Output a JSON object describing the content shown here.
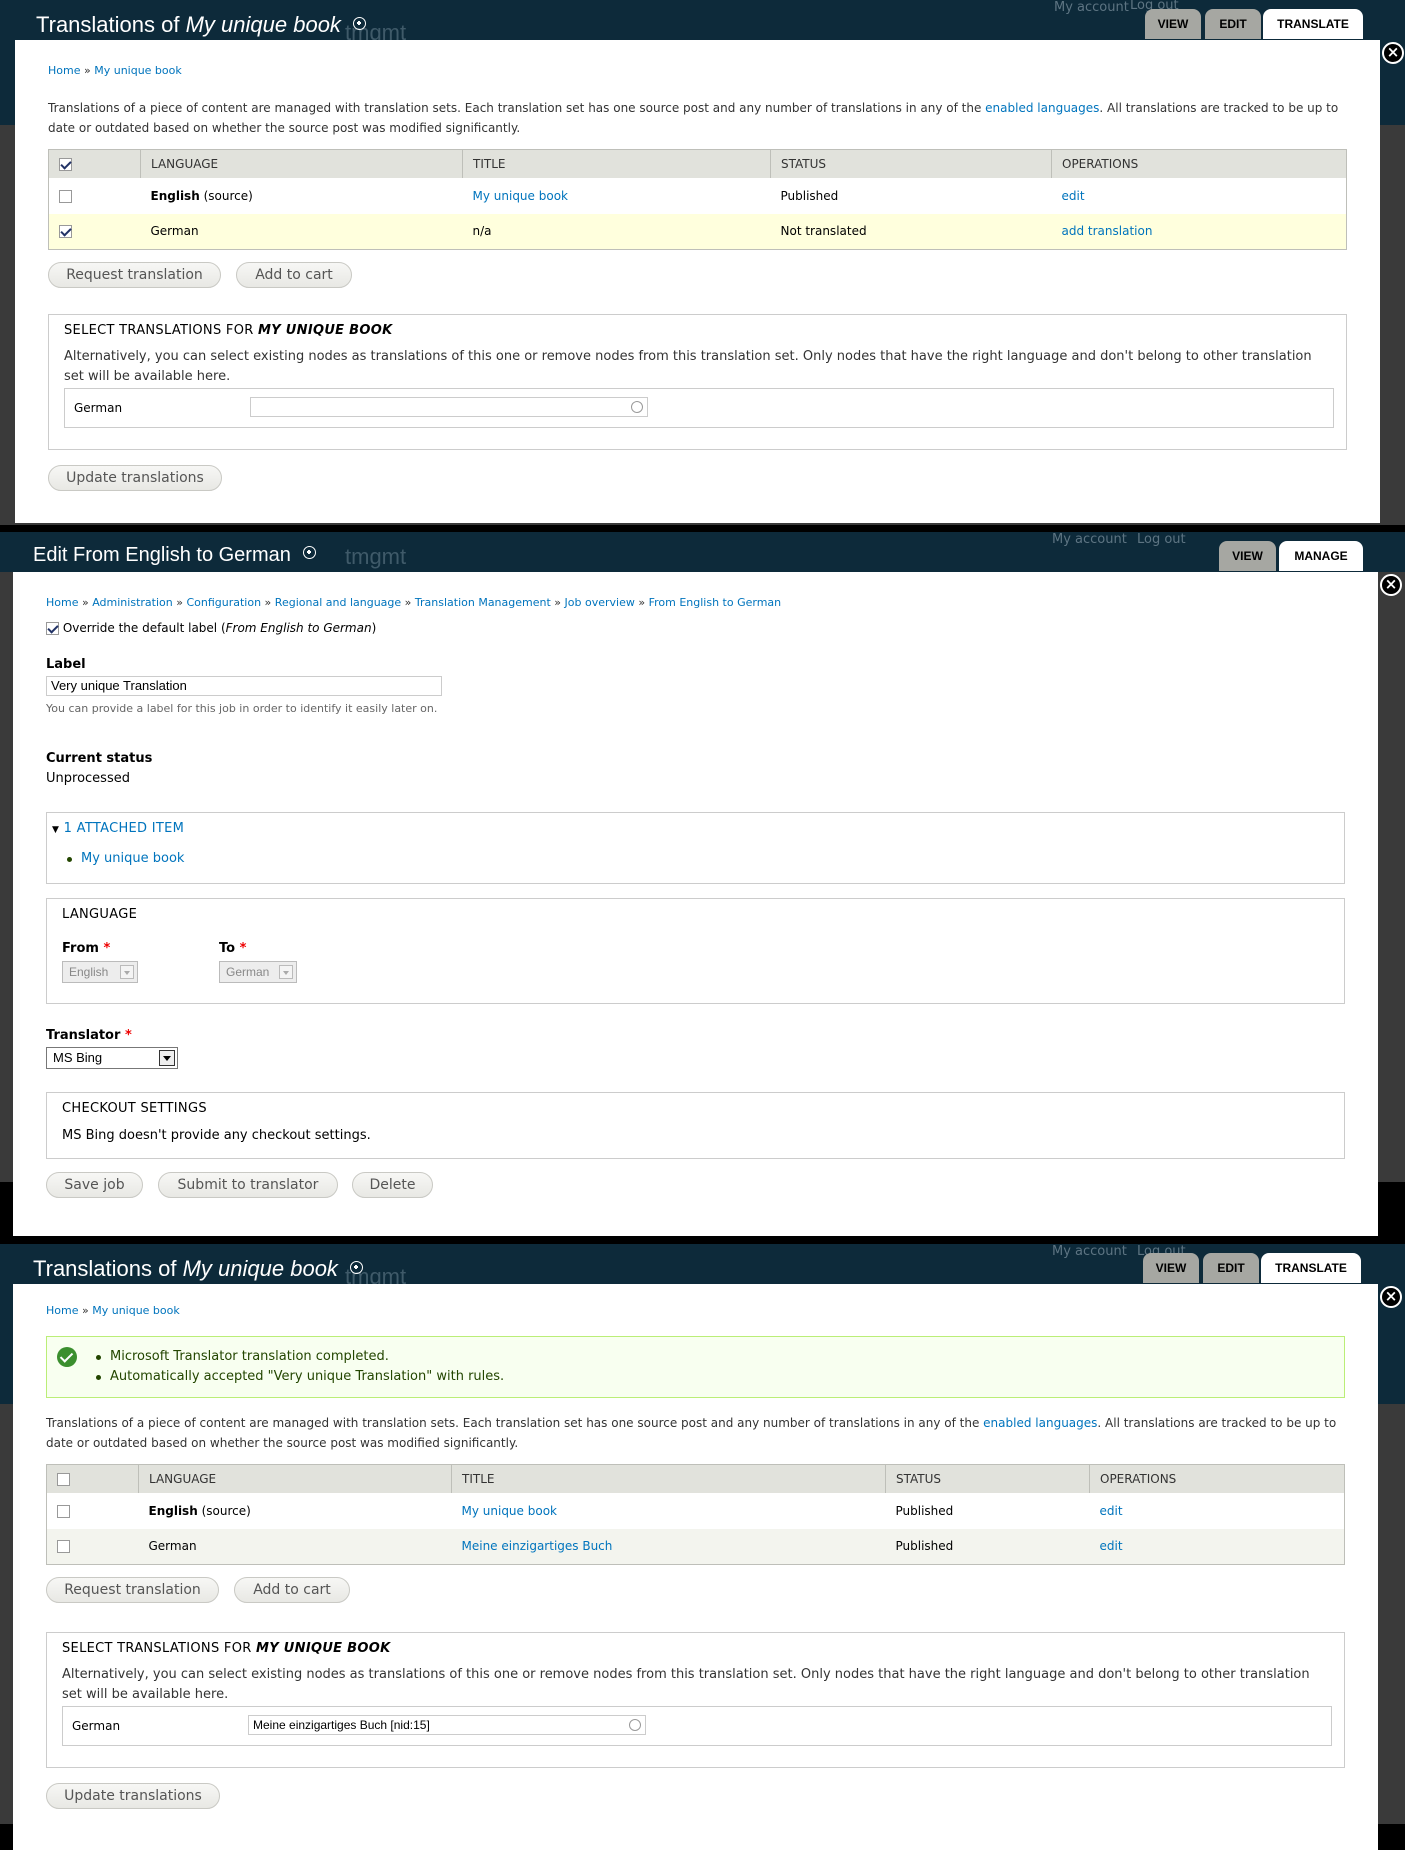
{
  "panel1": {
    "title_prefix": "Translations of",
    "title_node": "My unique book",
    "ghost": {
      "my_account": "My account",
      "log_out": "Log out",
      "site": "tmgmt"
    },
    "tabs": [
      "VIEW",
      "EDIT",
      "TRANSLATE"
    ],
    "breadcrumb": [
      "Home",
      "My unique book"
    ],
    "description_before": "Translations of a piece of content are managed with translation sets. Each translation set has one source post and any number of translations in any of the ",
    "description_link": "enabled languages",
    "description_after": ". All translations are tracked to be up to date or outdated based on whether the source post was modified significantly.",
    "table": {
      "headers": [
        "LANGUAGE",
        "TITLE",
        "STATUS",
        "OPERATIONS"
      ],
      "rows": [
        {
          "language": "English",
          "source": "(source)",
          "title": "My unique book",
          "status": "Published",
          "operation": "edit",
          "checked": false
        },
        {
          "language": "German",
          "title": "n/a",
          "status": "Not translated",
          "operation": "add translation",
          "checked": true
        }
      ]
    },
    "buttons": {
      "request": "Request translation",
      "cart": "Add to cart",
      "update": "Update translations"
    },
    "fieldset": {
      "legend_prefix": "SELECT TRANSLATIONS FOR",
      "legend_node": "MY UNIQUE BOOK",
      "description": "Alternatively, you can select existing nodes as translations of this one or remove nodes from this translation set. Only nodes that have the right language and don't belong to other translation set will be available here.",
      "field_label": "German",
      "field_value": ""
    }
  },
  "panel2": {
    "title": "Edit From English to German",
    "ghost": {
      "my_account": "My account",
      "log_out": "Log out",
      "site": "tmgmt"
    },
    "tabs": [
      "VIEW",
      "MANAGE"
    ],
    "breadcrumb": [
      "Home",
      "Administration",
      "Configuration",
      "Regional and language",
      "Translation Management",
      "Job overview",
      "From English to German"
    ],
    "override": {
      "label": "Override the default label (",
      "label_italic": "From English to German",
      "label_end": ")",
      "checked": true
    },
    "label_field": {
      "title": "Label",
      "value": "Very unique Translation",
      "help": "You can provide a label for this job in order to identify it easily later on."
    },
    "status": {
      "title": "Current status",
      "value": "Unprocessed"
    },
    "attached": {
      "legend": "1 ATTACHED ITEM",
      "items": [
        "My unique book"
      ]
    },
    "language": {
      "legend": "LANGUAGE",
      "from_label": "From",
      "from_value": "English",
      "to_label": "To",
      "to_value": "German"
    },
    "translator": {
      "label": "Translator",
      "value": "MS Bing"
    },
    "checkout": {
      "legend": "CHECKOUT SETTINGS",
      "text": "MS Bing doesn't provide any checkout settings."
    },
    "buttons": {
      "save": "Save job",
      "submit": "Submit to translator",
      "delete": "Delete"
    }
  },
  "panel3": {
    "title_prefix": "Translations of",
    "title_node": "My unique book",
    "ghost": {
      "my_account": "My account",
      "log_out": "Log out",
      "site": "tmgmt"
    },
    "tabs": [
      "VIEW",
      "EDIT",
      "TRANSLATE"
    ],
    "breadcrumb": [
      "Home",
      "My unique book"
    ],
    "messages": [
      "Microsoft Translator translation completed.",
      "Automatically accepted \"Very unique Translation\" with rules."
    ],
    "description_before": "Translations of a piece of content are managed with translation sets. Each translation set has one source post and any number of translations in any of the ",
    "description_link": "enabled languages",
    "description_after": ". All translations are tracked to be up to date or outdated based on whether the source post was modified significantly.",
    "table": {
      "headers": [
        "LANGUAGE",
        "TITLE",
        "STATUS",
        "OPERATIONS"
      ],
      "rows": [
        {
          "language": "English",
          "source": "(source)",
          "title": "My unique book",
          "status": "Published",
          "operation": "edit",
          "checked": false
        },
        {
          "language": "German",
          "title": "Meine einzigartiges Buch",
          "status": "Published",
          "operation": "edit",
          "checked": false
        }
      ]
    },
    "buttons": {
      "request": "Request translation",
      "cart": "Add to cart",
      "update": "Update translations"
    },
    "fieldset": {
      "legend_prefix": "SELECT TRANSLATIONS FOR",
      "legend_node": "MY UNIQUE BOOK",
      "description": "Alternatively, you can select existing nodes as translations of this one or remove nodes from this translation set. Only nodes that have the right language and don't belong to other translation set will be available here.",
      "field_label": "German",
      "field_value": "Meine einzigartiges Buch [nid:15]"
    }
  },
  "colors": {
    "link": "#0074bd",
    "toolbar": "#0d2a3a",
    "tab": "#a6a7a2",
    "selected_row": "#ffffdd",
    "message_bg": "#f8fff0",
    "message_border": "#bbee77"
  }
}
